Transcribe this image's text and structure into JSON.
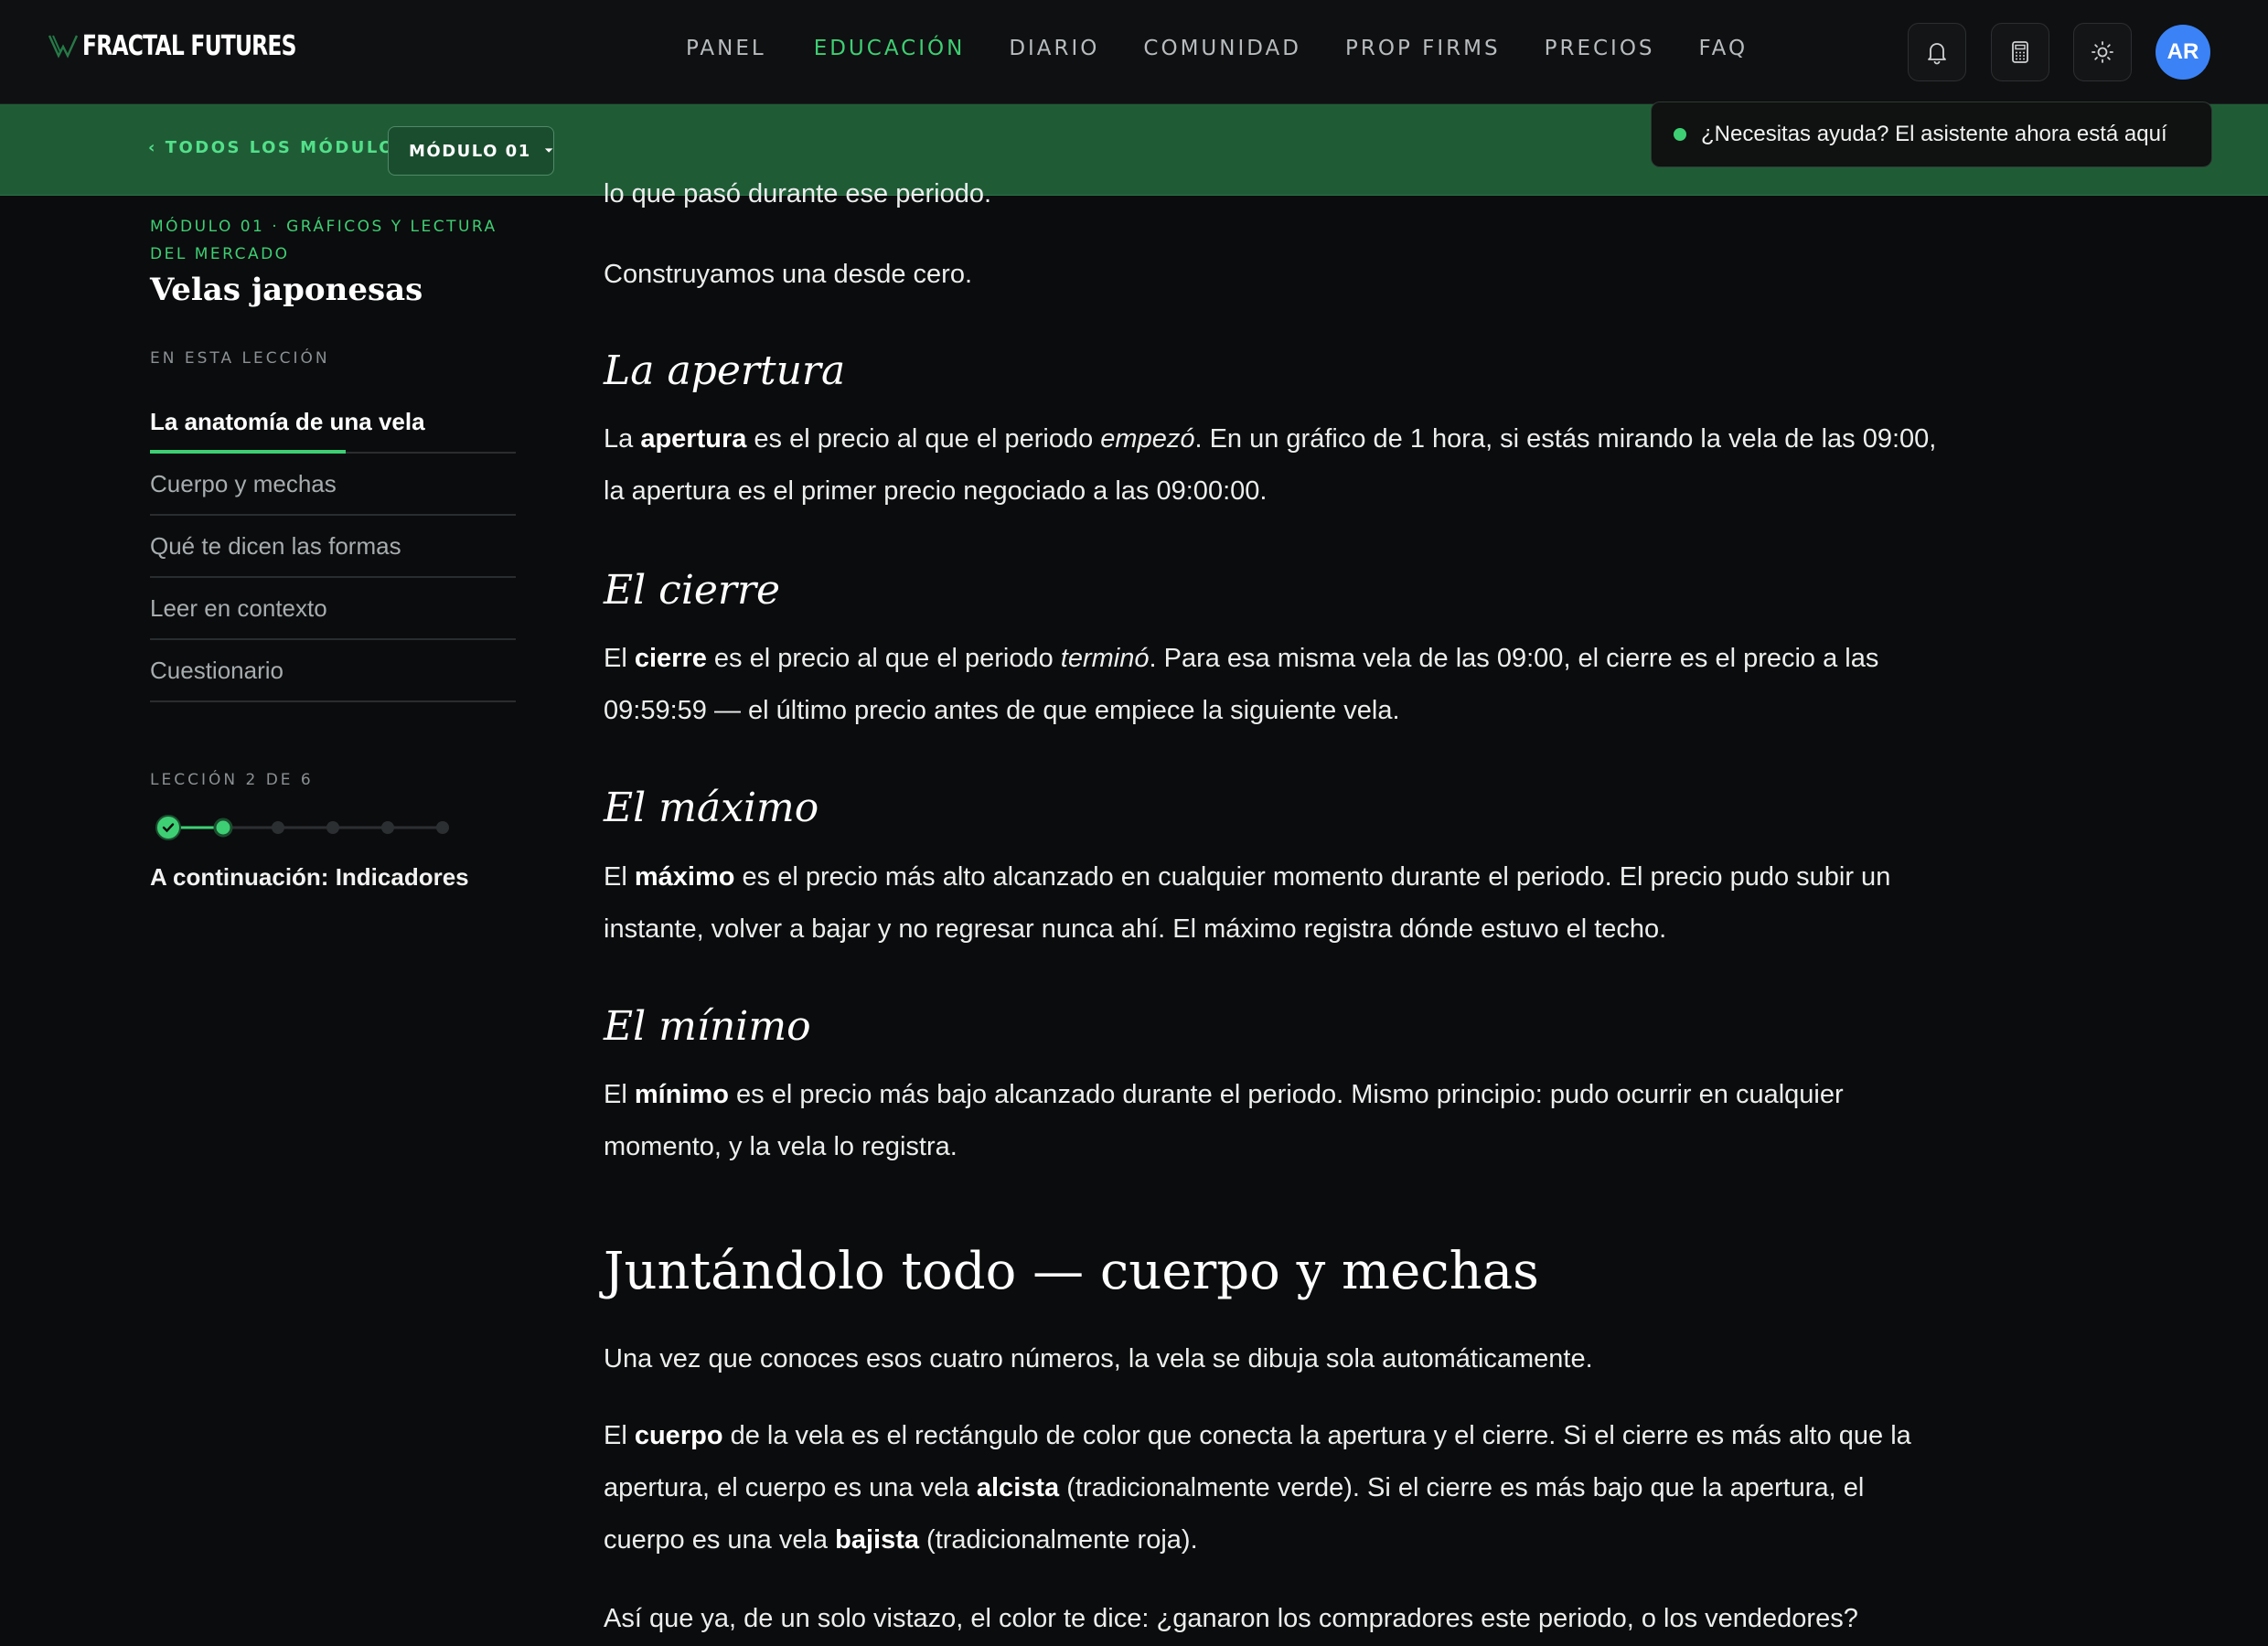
{
  "brand": {
    "name": "FRACTAL FUTURES"
  },
  "nav": {
    "items": [
      {
        "label": "PANEL",
        "active": false
      },
      {
        "label": "EDUCACIÓN",
        "active": true
      },
      {
        "label": "DIARIO",
        "active": false
      },
      {
        "label": "COMUNIDAD",
        "active": false
      },
      {
        "label": "PROP FIRMS",
        "active": false
      },
      {
        "label": "PRECIOS",
        "active": false
      },
      {
        "label": "FAQ",
        "active": false
      }
    ],
    "user_initials": "AR"
  },
  "module_bar": {
    "back_label": "TODOS LOS MÓDULOS",
    "separator": "·",
    "module_label": "MÓDULO 01"
  },
  "help": {
    "text": "¿Necesitas ayuda? El asistente ahora está aquí"
  },
  "sidebar": {
    "kicker": "MÓDULO 01 · GRÁFICOS Y LECTURA DEL MERCADO",
    "title": "Velas japonesas",
    "in_lesson_label": "EN ESTA LECCIÓN",
    "toc": [
      {
        "label": "La anatomía de una vela",
        "active": true
      },
      {
        "label": "Cuerpo y mechas",
        "active": false
      },
      {
        "label": "Qué te dicen las formas",
        "active": false
      },
      {
        "label": "Leer en contexto",
        "active": false
      },
      {
        "label": "Cuestionario",
        "active": false
      }
    ],
    "lesson_count": "LECCIÓN 2 DE 6",
    "progress": {
      "completed": 1,
      "current": 2,
      "total": 6
    },
    "next_label": "A continuación: Indicadores"
  },
  "article": {
    "cut_line": "lo que pasó durante ese periodo.",
    "intro": "Construyamos una desde cero.",
    "sections": [
      {
        "heading": "La apertura",
        "parts": [
          "La ",
          "apertura",
          " es el precio al que el periodo ",
          "empezó",
          ". En un gráfico de 1 hora, si estás mirando la vela de las 09:00, la apertura es el primer precio negociado a las 09:00:00."
        ]
      },
      {
        "heading": "El cierre",
        "parts": [
          "El ",
          "cierre",
          " es el precio al que el periodo ",
          "terminó",
          ". Para esa misma vela de las 09:00, el cierre es el precio a las 09:59:59 — el último precio antes de que empiece la siguiente vela."
        ]
      },
      {
        "heading": "El máximo",
        "parts": [
          "El ",
          "máximo",
          " es el precio más alto alcanzado en cualquier momento durante el periodo. El precio pudo subir un instante, volver a bajar y no regresar nunca ahí. El máximo registra dónde estuvo el techo."
        ]
      },
      {
        "heading": "El mínimo",
        "parts": [
          "El ",
          "mínimo",
          " es el precio más bajo alcanzado durante el periodo. Mismo principio: pudo ocurrir en cualquier momento, y la vela lo registra."
        ]
      }
    ],
    "h2": "Juntándolo todo — cuerpo y mechas",
    "p_after_h2": "Una vez que conoces esos cuatro números, la vela se dibuja sola automáticamente.",
    "body_parts": [
      "El ",
      "cuerpo",
      " de la vela es el rectángulo de color que conecta la apertura y el cierre. Si el cierre es más alto que la apertura, el cuerpo es una vela ",
      "alcista",
      " (tradicionalmente verde). Si el cierre es más bajo que la apertura, el cuerpo es una vela ",
      "bajista",
      " (tradicionalmente roja)."
    ],
    "last_line": "Así que ya, de un solo vistazo, el color te dice: ¿ganaron los compradores este periodo, o los vendedores?"
  },
  "colors": {
    "accent": "#3ecf74",
    "module_bar": "#1f5c36",
    "background": "#0b0c0d",
    "avatar": "#3b82f6"
  },
  "icons": [
    "logo-mark-icon",
    "bell-icon",
    "calculator-icon",
    "sun-icon",
    "chevron-left-icon",
    "chevron-down-icon",
    "check-icon"
  ]
}
